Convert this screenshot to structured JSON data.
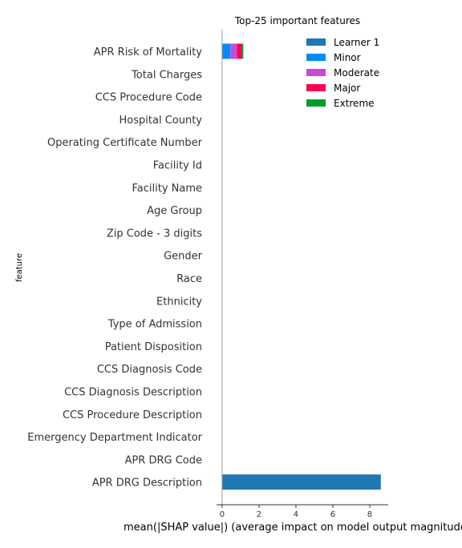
{
  "chart_data": {
    "type": "bar",
    "orientation": "horizontal",
    "stacked": true,
    "title": "Top-25 important features",
    "xlabel": "mean(|SHAP value|) (average impact on model output magnitude)",
    "ylabel": "feature",
    "xlim": [
      -0.3,
      9.0
    ],
    "xticks": [
      0,
      2,
      4,
      6,
      8
    ],
    "legend_position": "top-right",
    "categories": [
      "APR Risk of Mortality",
      "Total Charges",
      "CCS Procedure Code",
      "Hospital County",
      "Operating Certificate Number",
      "Facility Id",
      "Facility Name",
      "Age Group",
      "Zip Code - 3 digits",
      "Gender",
      "Race",
      "Ethnicity",
      "Type of Admission",
      "Patient Disposition",
      "CCS Diagnosis Code",
      "CCS Diagnosis Description",
      "CCS Procedure Description",
      "Emergency Department Indicator",
      "APR DRG Code",
      "APR DRG Description"
    ],
    "series": [
      {
        "name": "Learner 1",
        "color": "#1f77b4",
        "values": [
          0,
          0,
          0,
          0,
          0,
          0,
          0,
          0,
          0,
          0,
          0,
          0,
          0,
          0,
          0,
          0,
          0,
          0,
          0,
          8.6
        ]
      },
      {
        "name": "Minor",
        "color": "#008bfb",
        "values": [
          0.45,
          0,
          0,
          0,
          0,
          0,
          0,
          0,
          0,
          0,
          0,
          0,
          0,
          0,
          0,
          0,
          0,
          0,
          0,
          0
        ]
      },
      {
        "name": "Moderate",
        "color": "#c74bd6",
        "values": [
          0.35,
          0,
          0,
          0,
          0,
          0,
          0,
          0,
          0,
          0,
          0,
          0,
          0,
          0,
          0,
          0,
          0,
          0,
          0,
          0
        ]
      },
      {
        "name": "Major",
        "color": "#ff0051",
        "values": [
          0.25,
          0,
          0,
          0,
          0,
          0,
          0,
          0,
          0,
          0,
          0,
          0,
          0,
          0,
          0,
          0,
          0,
          0,
          0,
          0
        ]
      },
      {
        "name": "Extreme",
        "color": "#009a2d",
        "values": [
          0.1,
          0,
          0,
          0,
          0,
          0,
          0,
          0,
          0,
          0,
          0,
          0,
          0,
          0,
          0,
          0,
          0,
          0,
          0,
          0
        ]
      }
    ]
  }
}
